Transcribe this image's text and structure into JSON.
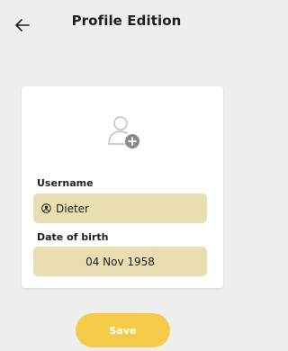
{
  "header": {
    "title": "Profile Edition",
    "back_icon": "arrow-left-icon"
  },
  "profile_card": {
    "avatar_icon": "add-user-icon",
    "username": {
      "label": "Username",
      "icon": "user-circle-icon",
      "value": "Dieter"
    },
    "date_of_birth": {
      "label": "Date of birth",
      "value": "04 Nov 1958"
    }
  },
  "actions": {
    "save_label": "Save"
  },
  "colors": {
    "background": "#eeeeef",
    "field_fill": "#e9ddb2",
    "save_button": "#f3cb49"
  }
}
